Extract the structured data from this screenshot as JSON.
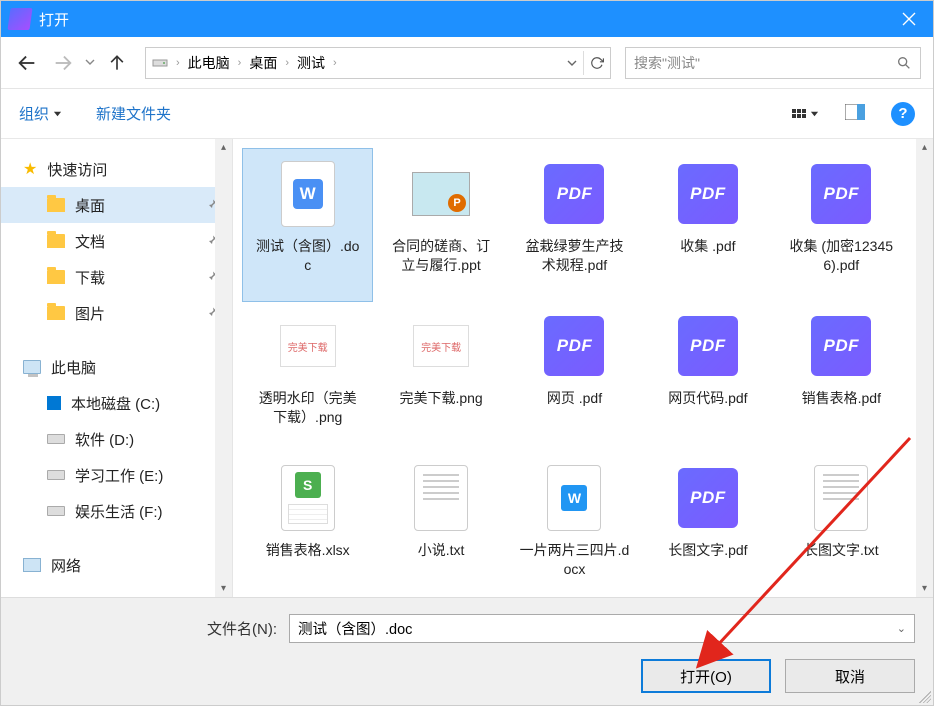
{
  "titlebar": {
    "title": "打开"
  },
  "breadcrumb": {
    "items": [
      "此电脑",
      "桌面",
      "测试"
    ]
  },
  "search": {
    "placeholder": "搜索\"测试\""
  },
  "toolbar": {
    "organize": "组织",
    "new_folder": "新建文件夹"
  },
  "sidebar": {
    "quick_access": "快速访问",
    "desktop": "桌面",
    "documents": "文档",
    "downloads": "下载",
    "pictures": "图片",
    "this_pc": "此电脑",
    "drive_c": "本地磁盘 (C:)",
    "drive_d": "软件 (D:)",
    "drive_e": "学习工作 (E:)",
    "drive_f": "娱乐生活 (F:)",
    "network": "网络"
  },
  "files": [
    {
      "name": "测试（含图）.doc",
      "type": "doc",
      "selected": true
    },
    {
      "name": "合同的磋商、订立与履行.ppt",
      "type": "ppt"
    },
    {
      "name": "盆栽绿萝生产技术规程.pdf",
      "type": "pdf"
    },
    {
      "name": "收集 .pdf",
      "type": "pdf"
    },
    {
      "name": "收集 (加密123456).pdf",
      "type": "pdf"
    },
    {
      "name": "透明水印（完美下载）.png",
      "type": "png",
      "thumbtext": "完美下载"
    },
    {
      "name": "完美下载.png",
      "type": "png",
      "thumbtext": "完美下载"
    },
    {
      "name": "网页 .pdf",
      "type": "pdf"
    },
    {
      "name": "网页代码.pdf",
      "type": "pdf"
    },
    {
      "name": "销售表格.pdf",
      "type": "pdf"
    },
    {
      "name": "销售表格.xlsx",
      "type": "xlsx"
    },
    {
      "name": "小说.txt",
      "type": "txt"
    },
    {
      "name": "一片两片三四片.docx",
      "type": "docx"
    },
    {
      "name": "长图文字.pdf",
      "type": "pdf"
    },
    {
      "name": "长图文字.txt",
      "type": "txt"
    }
  ],
  "footer": {
    "filename_label": "文件名(N):",
    "filename_value": "测试（含图）.doc",
    "open": "打开(O)",
    "cancel": "取消"
  },
  "icons": {
    "pdf_text": "PDF"
  }
}
